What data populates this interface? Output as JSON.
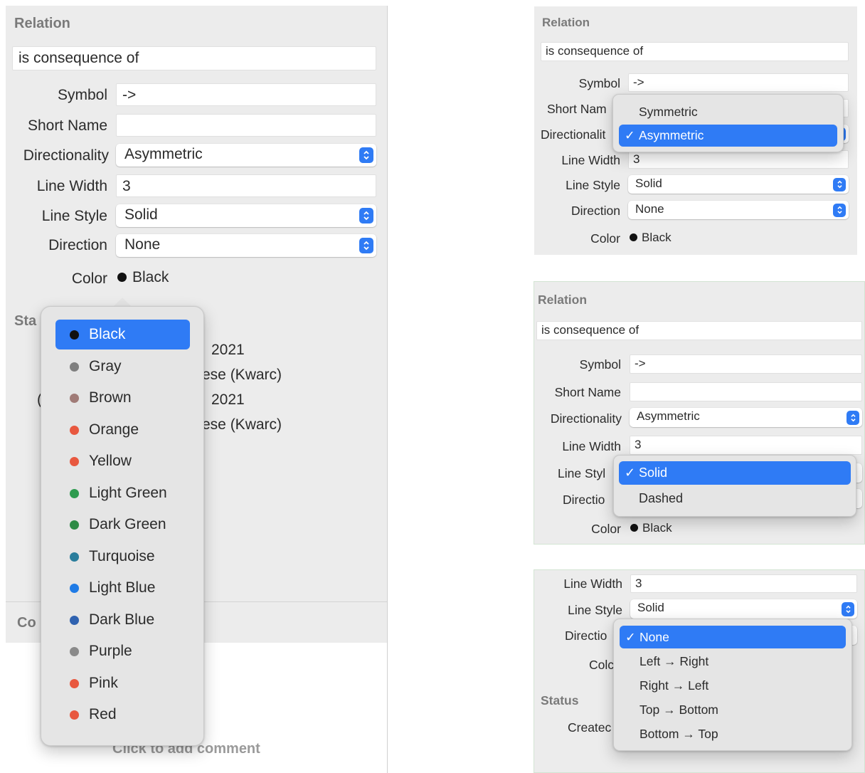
{
  "left": {
    "section_relation": "Relation",
    "relation_name": "is consequence of",
    "symbol_label": "Symbol",
    "symbol_value": "->",
    "short_name_label": "Short Name",
    "short_name_value": "",
    "directionality_label": "Directionality",
    "directionality_value": "Asymmetric",
    "line_width_label": "Line Width",
    "line_width_value": "3",
    "line_style_label": "Line Style",
    "line_style_value": "Solid",
    "direction_label": "Direction",
    "direction_value": "None",
    "color_label": "Color",
    "color_value": "Black",
    "color_value_hex": "#111111",
    "status_partial": "Sta",
    "row1_partial": "2021",
    "row2_partial": "ese (Kwarc)",
    "row3_prefix": "(",
    "row3_partial": "2021",
    "row4_partial": "ese (Kwarc)",
    "comments_partial": "Co",
    "add_comment": "Click to add comment",
    "color_menu": [
      {
        "label": "Black",
        "color": "#111111",
        "selected": true
      },
      {
        "label": "Gray",
        "color": "#7f7f7f"
      },
      {
        "label": "Brown",
        "color": "#a07b77"
      },
      {
        "label": "Orange",
        "color": "#e8583f"
      },
      {
        "label": "Yellow",
        "color": "#e8583f"
      },
      {
        "label": "Light Green",
        "color": "#2e9b4f"
      },
      {
        "label": "Dark Green",
        "color": "#2e8b46"
      },
      {
        "label": "Turquoise",
        "color": "#2a7d9c"
      },
      {
        "label": "Light Blue",
        "color": "#1f7be6"
      },
      {
        "label": "Dark Blue",
        "color": "#2f62b0"
      },
      {
        "label": "Purple",
        "color": "#8a8a8a"
      },
      {
        "label": "Pink",
        "color": "#e8583f"
      },
      {
        "label": "Red",
        "color": "#e8583f"
      }
    ]
  },
  "top_right": {
    "section_relation": "Relation",
    "relation_name": "is consequence of",
    "symbol_label": "Symbol",
    "symbol_value": "->",
    "short_name_label": "Short Nam",
    "directionality_label": "Directionalit",
    "line_width_label": "Line Width",
    "line_width_value": "3",
    "line_style_label": "Line Style",
    "line_style_value": "Solid",
    "direction_label": "Direction",
    "direction_value": "None",
    "color_label": "Color",
    "color_value": "Black",
    "menu": [
      {
        "label": "Symmetric"
      },
      {
        "label": "Asymmetric",
        "selected": true,
        "check": "✓"
      }
    ]
  },
  "middle_right": {
    "section_relation": "Relation",
    "relation_name": "is consequence of",
    "symbol_label": "Symbol",
    "symbol_value": "->",
    "short_name_label": "Short Name",
    "short_name_value": "",
    "directionality_label": "Directionality",
    "directionality_value": "Asymmetric",
    "line_width_label": "Line Width",
    "line_width_value": "3",
    "line_style_label": "Line Styl",
    "direction_label": "Directio",
    "color_label": "Color",
    "color_value": "Black",
    "menu": [
      {
        "label": "Solid",
        "selected": true,
        "check": "✓"
      },
      {
        "label": "Dashed"
      }
    ]
  },
  "bottom_right": {
    "line_width_label": "Line Width",
    "line_width_value": "3",
    "line_style_label": "Line Style",
    "line_style_value": "Solid",
    "direction_label": "Directio",
    "color_label": "Colc",
    "status_label": "Status",
    "created_label": "Createc",
    "menu": [
      {
        "label": "None",
        "selected": true,
        "check": "✓"
      },
      {
        "label": "Left → Right"
      },
      {
        "label": "Right → Left"
      },
      {
        "label": "Top → Bottom"
      },
      {
        "label": "Bottom → Top"
      }
    ]
  }
}
